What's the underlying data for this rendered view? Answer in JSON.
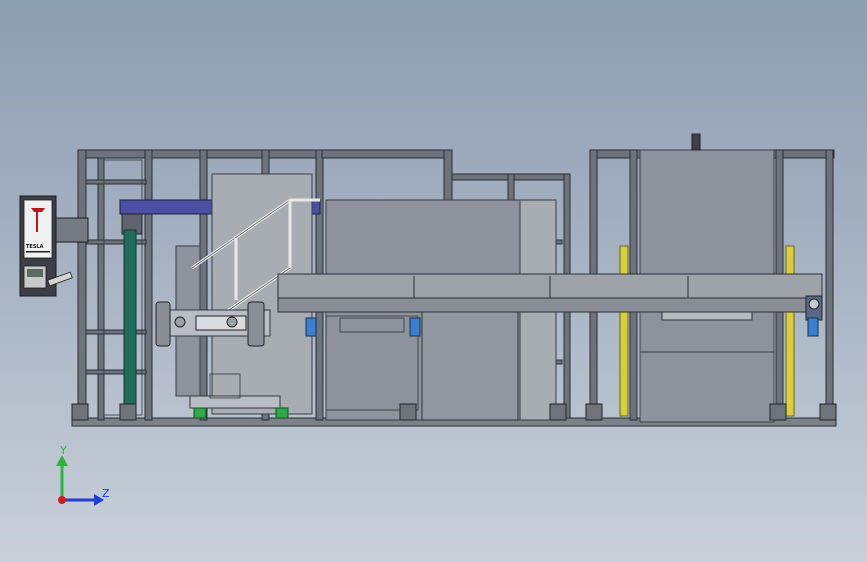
{
  "control_panel": {
    "brand_text": "TESLA"
  },
  "axes": {
    "y_label": "Y",
    "z_label": "Z",
    "colors": {
      "y": "#2fb33c",
      "z": "#1f3fd6",
      "origin": "#d11a1a"
    }
  },
  "colors": {
    "background_top": "#8e9db1",
    "background_bottom": "#c9d0da",
    "accent_blue": "#4b4fa3",
    "accent_teal": "#1f6b5c",
    "accent_yellow": "#d8cf3a",
    "accent_green": "#2fa84a"
  }
}
